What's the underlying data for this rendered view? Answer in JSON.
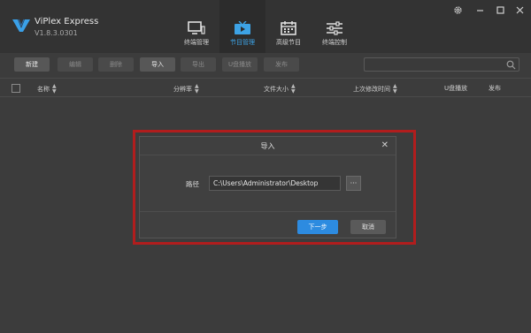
{
  "app": {
    "name": "ViPlex Express",
    "version": "V1.8.3.0301"
  },
  "nav": {
    "items": [
      {
        "label": "终端管理",
        "icon": "monitor-icon",
        "active": false
      },
      {
        "label": "节目管理",
        "icon": "play-screen-icon",
        "active": true
      },
      {
        "label": "高级节目",
        "icon": "calendar-icon",
        "active": false
      },
      {
        "label": "终端控制",
        "icon": "sliders-icon",
        "active": false
      }
    ]
  },
  "window": {
    "settings_icon": "gear-icon",
    "minimize_icon": "minimize-icon",
    "maximize_icon": "maximize-icon",
    "close_icon": "close-icon"
  },
  "toolbar": {
    "new_label": "新建",
    "edit_label": "编辑",
    "delete_label": "删除",
    "import_label": "导入",
    "export_label": "导出",
    "usb_play_label": "U盘播放",
    "publish_label": "发布",
    "search_placeholder": "",
    "search_icon": "search-icon"
  },
  "table": {
    "columns": [
      "名称",
      "分辨率",
      "文件大小",
      "上次修改时间",
      "U盘播放",
      "发布"
    ]
  },
  "dialog": {
    "title": "导入",
    "path_label": "路径",
    "path_value": "C:\\Users\\Administrator\\Desktop",
    "browse_label": "···",
    "next_label": "下一步",
    "cancel_label": "取消"
  },
  "colors": {
    "background": "#3c3c3c",
    "titlebar": "#333333",
    "accent": "#2d8be0",
    "active_nav": "#3da3e6",
    "highlight_frame": "#b11d1d"
  }
}
